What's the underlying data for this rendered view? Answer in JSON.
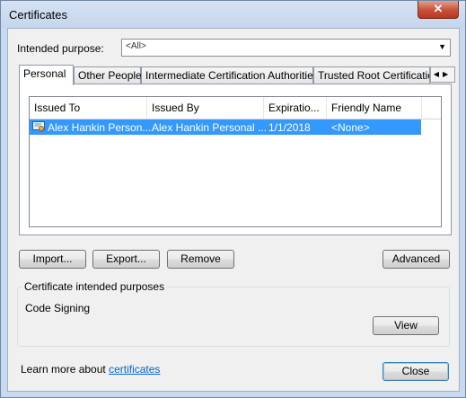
{
  "window": {
    "title": "Certificates",
    "close_glyph": "✕"
  },
  "purpose": {
    "label": "Intended purpose:",
    "value": "<All>"
  },
  "tabs": [
    {
      "label": "Personal"
    },
    {
      "label": "Other People"
    },
    {
      "label": "Intermediate Certification Authorities"
    },
    {
      "label": "Trusted Root Certification"
    }
  ],
  "tab_scroll": {
    "left": "◀",
    "right": "▶"
  },
  "list": {
    "columns": [
      "Issued To",
      "Issued By",
      "Expiratio...",
      "Friendly Name"
    ],
    "rows": [
      {
        "issued_to": "Alex Hankin Person...",
        "issued_by": "Alex Hankin Personal ...",
        "expiration": "1/1/2018",
        "friendly_name": "<None>",
        "selected": true
      }
    ]
  },
  "buttons": {
    "import": "Import...",
    "export": "Export...",
    "remove": "Remove",
    "advanced": "Advanced",
    "view": "View",
    "close": "Close"
  },
  "purposes_group": {
    "title": "Certificate intended purposes",
    "value": "Code Signing"
  },
  "footer": {
    "text": "Learn more about ",
    "link": "certificates"
  },
  "colors": {
    "selection": "#3399ff",
    "link": "#0066cc",
    "close": "#c7503b"
  }
}
